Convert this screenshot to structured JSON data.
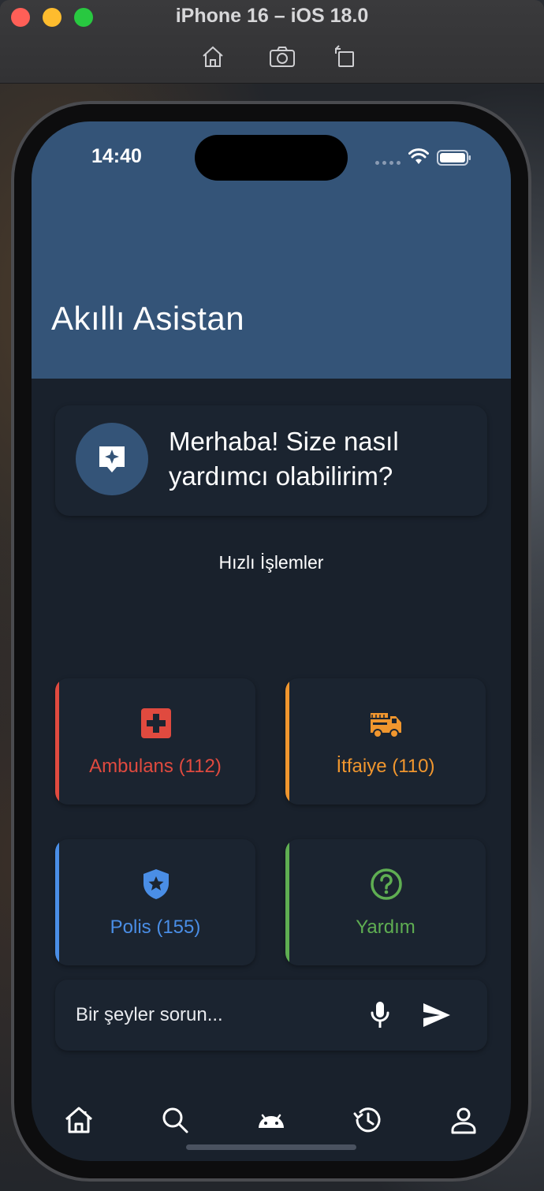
{
  "window": {
    "title": "iPhone 16 – iOS 18.0",
    "tools": [
      "home-icon",
      "screenshot-icon",
      "rotate-icon"
    ]
  },
  "status_bar": {
    "time": "14:40"
  },
  "app": {
    "title": "Akıllı Asistan"
  },
  "greeting": {
    "text": "Merhaba! Size nasıl yardımcı olabilirim?"
  },
  "quick_actions": {
    "title": "Hızlı İşlemler",
    "items": [
      {
        "label": "Ambulans (112)",
        "color": "#e04a3f",
        "icon": "medical-cross-icon"
      },
      {
        "label": "İtfaiye (110)",
        "color": "#f0962e",
        "icon": "fire-truck-icon"
      },
      {
        "label": "Polis (155)",
        "color": "#4a8ee6",
        "icon": "police-shield-icon"
      },
      {
        "label": "Yardım",
        "color": "#5fae52",
        "icon": "help-icon"
      }
    ]
  },
  "chat_input": {
    "placeholder": "Bir şeyler sorun..."
  },
  "bottom_nav": {
    "items": [
      "home-icon",
      "search-icon",
      "android-icon",
      "history-icon",
      "profile-icon"
    ]
  },
  "colors": {
    "header": "#345478",
    "background": "#19212c",
    "card": "#1b2430"
  }
}
